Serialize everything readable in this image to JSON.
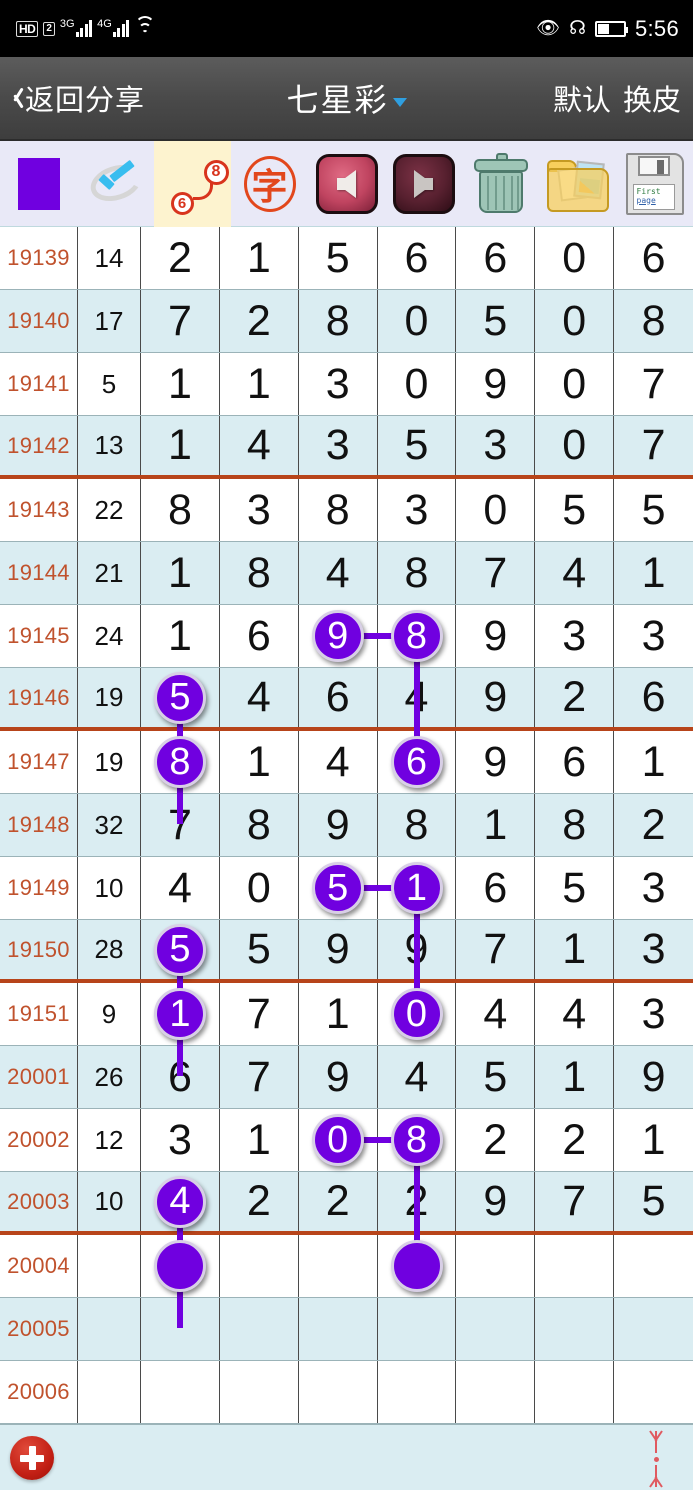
{
  "status_bar": {
    "hd_label": "HD",
    "sim_label": "2",
    "net1_label": "3G",
    "net2_label": "4G",
    "wifi_icon": "wifi-icon",
    "eye_icon": "eye-icon",
    "bluetooth_icon": "bluetooth-icon",
    "battery_icon": "battery-icon",
    "time": "5:56"
  },
  "title_bar": {
    "back_label": "返回分享",
    "back_icon": "chevron-left-icon",
    "title": "七星彩",
    "dropdown_icon": "chevron-down-icon",
    "right_labels": [
      "默认",
      "换皮"
    ]
  },
  "toolbar": {
    "items": [
      {
        "name": "color-swatch-button",
        "icon": "purple-square-icon",
        "label": "",
        "active": false
      },
      {
        "name": "check-mark-button",
        "icon": "check-ellipse-icon",
        "label": "",
        "active": false
      },
      {
        "name": "connect-numbers-button",
        "icon": "link-6-8-icon",
        "label_a": "6",
        "label_b": "8",
        "active": true
      },
      {
        "name": "text-mode-button",
        "icon": "zi-character-icon",
        "label": "字",
        "active": false
      },
      {
        "name": "previous-button",
        "icon": "arrow-left-icon",
        "label": "",
        "active": false
      },
      {
        "name": "next-button",
        "icon": "arrow-right-icon",
        "label": "",
        "active": false
      },
      {
        "name": "delete-button",
        "icon": "trash-bin-icon",
        "label": "",
        "active": false
      },
      {
        "name": "gallery-button",
        "icon": "folder-photos-icon",
        "label": "",
        "active": false
      },
      {
        "name": "save-button",
        "icon": "floppy-disk-icon",
        "label_line1": "First",
        "label_line2": "page",
        "active": false
      }
    ]
  },
  "table": {
    "accent_purple": "#7000e0",
    "separator_red": "#b7441a",
    "issue_text_color": "#c0522d",
    "alt_row_bg": "#daedf2",
    "rows": [
      {
        "issue": "19139",
        "sum": "14",
        "digits": [
          "2",
          "1",
          "5",
          "6",
          "6",
          "0",
          "6"
        ],
        "alt": false,
        "redline": false,
        "marks": []
      },
      {
        "issue": "19140",
        "sum": "17",
        "digits": [
          "7",
          "2",
          "8",
          "0",
          "5",
          "0",
          "8"
        ],
        "alt": true,
        "redline": false,
        "marks": []
      },
      {
        "issue": "19141",
        "sum": "5",
        "digits": [
          "1",
          "1",
          "3",
          "0",
          "9",
          "0",
          "7"
        ],
        "alt": false,
        "redline": false,
        "marks": []
      },
      {
        "issue": "19142",
        "sum": "13",
        "digits": [
          "1",
          "4",
          "3",
          "5",
          "3",
          "0",
          "7"
        ],
        "alt": true,
        "redline": true,
        "marks": []
      },
      {
        "issue": "19143",
        "sum": "22",
        "digits": [
          "8",
          "3",
          "8",
          "3",
          "0",
          "5",
          "5"
        ],
        "alt": false,
        "redline": false,
        "marks": []
      },
      {
        "issue": "19144",
        "sum": "21",
        "digits": [
          "1",
          "8",
          "4",
          "8",
          "7",
          "4",
          "1"
        ],
        "alt": true,
        "redline": false,
        "marks": []
      },
      {
        "issue": "19145",
        "sum": "24",
        "digits": [
          "1",
          "6",
          "9",
          "8",
          "9",
          "3",
          "3"
        ],
        "alt": false,
        "redline": false,
        "marks": [
          {
            "col": 2,
            "link_right": true
          },
          {
            "col": 3,
            "link_down": true
          }
        ]
      },
      {
        "issue": "19146",
        "sum": "19",
        "digits": [
          "5",
          "4",
          "6",
          "4",
          "9",
          "2",
          "6"
        ],
        "alt": true,
        "redline": true,
        "marks": [
          {
            "col": 0,
            "link_down": true
          }
        ]
      },
      {
        "issue": "19147",
        "sum": "19",
        "digits": [
          "8",
          "1",
          "4",
          "6",
          "9",
          "6",
          "1"
        ],
        "alt": false,
        "redline": false,
        "marks": [
          {
            "col": 0
          },
          {
            "col": 3
          }
        ]
      },
      {
        "issue": "19148",
        "sum": "32",
        "digits": [
          "7",
          "8",
          "9",
          "8",
          "1",
          "8",
          "2"
        ],
        "alt": true,
        "redline": false,
        "marks": []
      },
      {
        "issue": "19149",
        "sum": "10",
        "digits": [
          "4",
          "0",
          "5",
          "1",
          "6",
          "5",
          "3"
        ],
        "alt": false,
        "redline": false,
        "marks": [
          {
            "col": 2,
            "link_right": true
          },
          {
            "col": 3,
            "link_down": true
          }
        ]
      },
      {
        "issue": "19150",
        "sum": "28",
        "digits": [
          "5",
          "5",
          "9",
          "9",
          "7",
          "1",
          "3"
        ],
        "alt": true,
        "redline": true,
        "marks": [
          {
            "col": 0,
            "link_down": true
          }
        ]
      },
      {
        "issue": "19151",
        "sum": "9",
        "digits": [
          "1",
          "7",
          "1",
          "0",
          "4",
          "4",
          "3"
        ],
        "alt": false,
        "redline": false,
        "marks": [
          {
            "col": 0
          },
          {
            "col": 3
          }
        ]
      },
      {
        "issue": "20001",
        "sum": "26",
        "digits": [
          "6",
          "7",
          "9",
          "4",
          "5",
          "1",
          "9"
        ],
        "alt": true,
        "redline": false,
        "marks": []
      },
      {
        "issue": "20002",
        "sum": "12",
        "digits": [
          "3",
          "1",
          "0",
          "8",
          "2",
          "2",
          "1"
        ],
        "alt": false,
        "redline": false,
        "marks": [
          {
            "col": 2,
            "link_right": true
          },
          {
            "col": 3,
            "link_down": true
          }
        ]
      },
      {
        "issue": "20003",
        "sum": "10",
        "digits": [
          "4",
          "2",
          "2",
          "2",
          "9",
          "7",
          "5"
        ],
        "alt": true,
        "redline": true,
        "marks": [
          {
            "col": 0,
            "link_down": true
          }
        ]
      },
      {
        "issue": "20004",
        "sum": "",
        "digits": [
          "",
          "",
          "",
          "",
          "",
          "",
          ""
        ],
        "alt": false,
        "redline": false,
        "marks": [
          {
            "col": 0,
            "blank": true
          },
          {
            "col": 3,
            "blank": true
          }
        ]
      },
      {
        "issue": "20005",
        "sum": "",
        "digits": [
          "",
          "",
          "",
          "",
          "",
          "",
          ""
        ],
        "alt": true,
        "redline": false,
        "marks": []
      },
      {
        "issue": "20006",
        "sum": "",
        "digits": [
          "",
          "",
          "",
          "",
          "",
          "",
          ""
        ],
        "alt": false,
        "redline": false,
        "marks": []
      }
    ]
  },
  "bottom_bar": {
    "add_button_icon": "plus-circle-icon",
    "scroll_control_icon": "scroll-updown-icon"
  }
}
